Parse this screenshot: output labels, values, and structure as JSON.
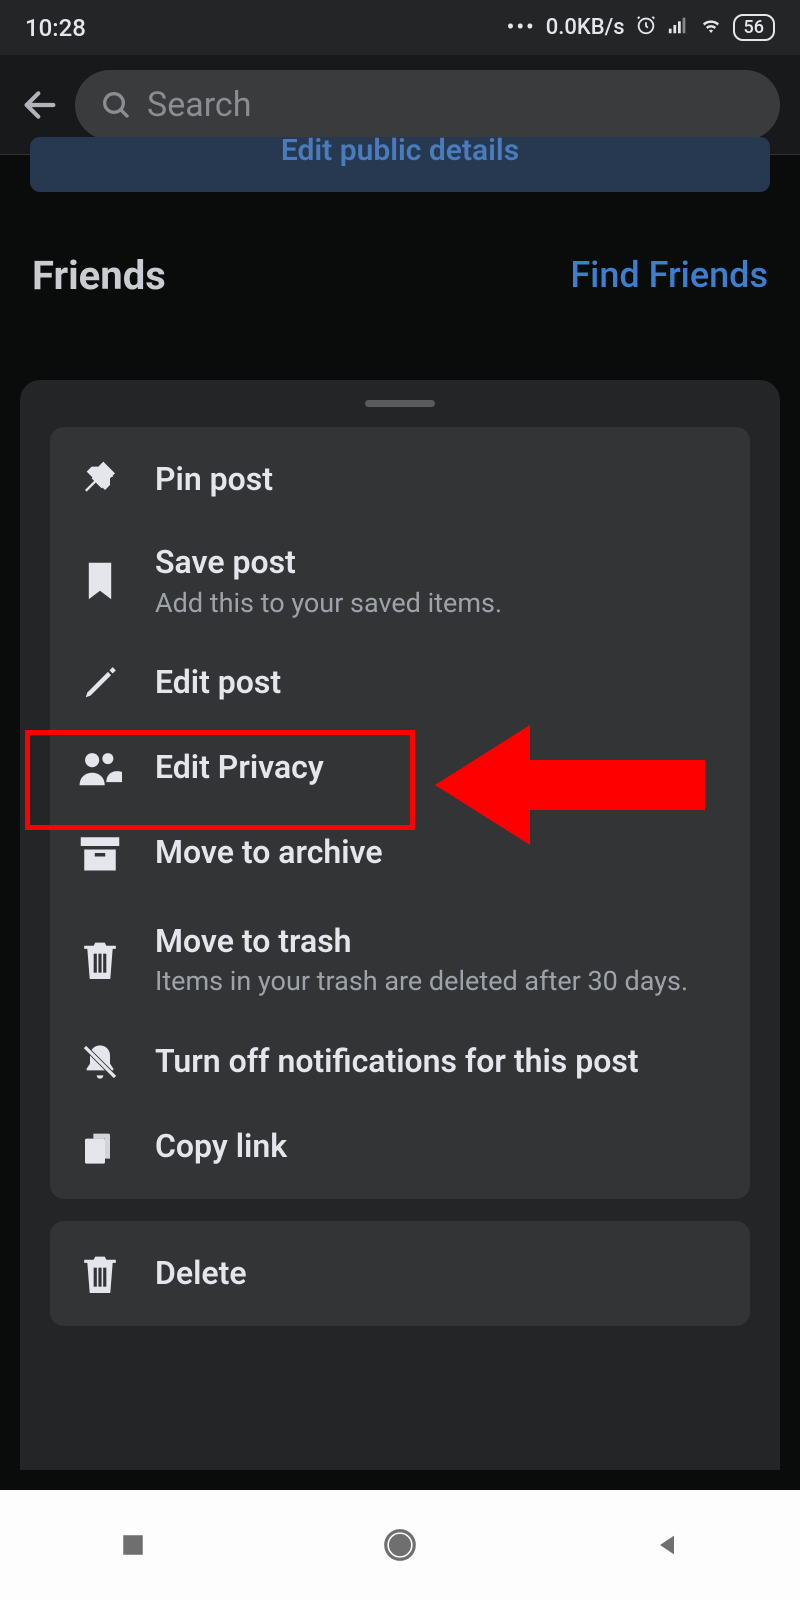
{
  "status_bar": {
    "time": "10:28",
    "data_rate": "0.0KB/s",
    "battery": "56"
  },
  "header": {
    "search_placeholder": "Search",
    "edit_public": "Edit public details"
  },
  "friends_section": {
    "title": "Friends",
    "find_friends": "Find Friends"
  },
  "menu": {
    "items": [
      {
        "title": "Pin post",
        "subtitle": "",
        "icon": "pin-icon"
      },
      {
        "title": "Save post",
        "subtitle": "Add this to your saved items.",
        "icon": "bookmark-icon"
      },
      {
        "title": "Edit post",
        "subtitle": "",
        "icon": "pencil-icon"
      },
      {
        "title": "Edit Privacy",
        "subtitle": "",
        "icon": "people-icon"
      },
      {
        "title": "Move to archive",
        "subtitle": "",
        "icon": "archive-icon"
      },
      {
        "title": "Move to trash",
        "subtitle": "Items in your trash are deleted after 30 days.",
        "icon": "trash-icon"
      },
      {
        "title": "Turn off notifications for this post",
        "subtitle": "",
        "icon": "bell-off-icon"
      },
      {
        "title": "Copy link",
        "subtitle": "",
        "icon": "copy-icon"
      }
    ],
    "delete": {
      "title": "Delete",
      "icon": "trash-icon"
    }
  },
  "annotation": {
    "highlighted_item_index": 3,
    "arrow_color": "#ff0000"
  }
}
